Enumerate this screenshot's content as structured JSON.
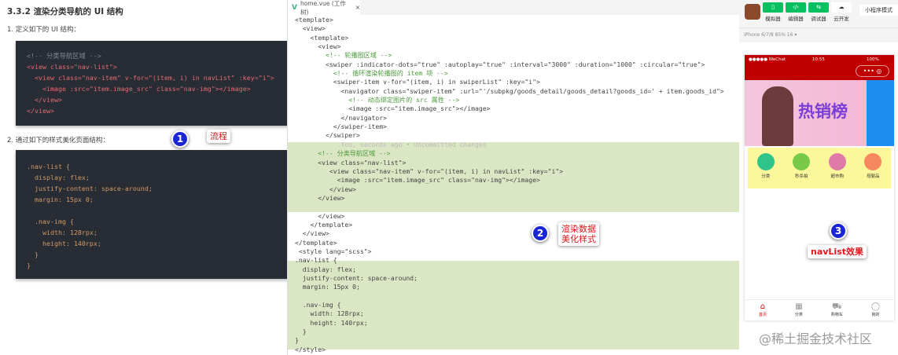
{
  "doc": {
    "heading": "3.3.2 渲染分类导航的 UI 结构",
    "step1": "1. 定义如下的 UI 结构：",
    "code1": [
      "<!-- 分类导航区域 -->",
      "<view class=\"nav-list\">",
      "  <view class=\"nav-item\" v-for=\"(item, i) in navList\" :key=\"i\">",
      "    <image :src=\"item.image_src\" class=\"nav-img\"></image>",
      "  </view>",
      "</view>"
    ],
    "step2": "2. 通过如下的样式美化页面结构：",
    "code2": [
      ".nav-list {",
      "  display: flex;",
      "  justify-content: space-around;",
      "  margin: 15px 0;",
      "",
      "  .nav-img {",
      "    width: 128rpx;",
      "    height: 140rpx;",
      "  }",
      "}"
    ]
  },
  "annotations": [
    {
      "number": "1",
      "label": "流程"
    },
    {
      "number": "2",
      "label_line1": "渲染数据",
      "label_line2": "美化样式"
    },
    {
      "number": "3",
      "label": "navList效果"
    }
  ],
  "editor": {
    "tab_label": "home.vue (工作树)",
    "lines": [
      "<template>",
      "  <view>",
      "    <template>",
      "      <view>",
      "        <!-- 轮播图区域 -->",
      "        <swiper :indicator-dots=\"true\" :autoplay=\"true\" :interval=\"3000\" :duration=\"1000\" :circular=\"true\">",
      "          <!-- 循环渲染轮播图的 item 项 -->",
      "          <swiper-item v-for=\"(item, i) in swiperList\" :key=\"i\">",
      "            <navigator class=\"swiper-item\" :url=\"'/subpkg/goods_detail/goods_detail?goods_id=' + item.goods_id\">",
      "              <!-- 动态绑定图片的 src 属性 -->",
      "              <image :src=\"item.image_src\"></image>",
      "            </navigator>",
      "          </swiper-item>",
      "        </swiper>",
      "            You, seconds ago • Uncommitted changes",
      "      <!-- 分类导航区域 -->",
      "      <view class=\"nav-list\">",
      "         <view class=\"nav-item\" v-for=\"(item, i) in navList\" :key=\"i\">",
      "           <image :src=\"item.image_src\" class=\"nav-img\"></image>",
      "         </view>",
      "      </view>",
      "",
      "      </view>",
      "    </template>",
      "  </view>",
      "</template>",
      " <style lang=\"scss\">",
      ".nav-list {",
      "  display: flex;",
      "  justify-content: space-around;",
      "  margin: 15px 0;",
      "",
      "  .nav-img {",
      "    width: 128rpx;",
      "    height: 140rpx;",
      "  }",
      "}",
      "</style>"
    ]
  },
  "simulator": {
    "toolbar": [
      {
        "icon": "phone-icon",
        "label": "模拟器"
      },
      {
        "icon": "code-icon",
        "label": "编辑器"
      },
      {
        "icon": "debug-icon",
        "label": "调试器"
      },
      {
        "icon": "cloud-icon",
        "label": "云开发"
      }
    ],
    "mode": "小程序模式",
    "device": "iPhone 6/7/8 85% 16 ▾",
    "status": {
      "carrier": "●●●●● WeChat",
      "time": "10:55",
      "battery": "100%"
    },
    "banner_text": "热销榜",
    "nav_items": [
      {
        "label": "分类",
        "color": "#2fc58a"
      },
      {
        "label": "秒杀拍",
        "color": "#78c94a"
      },
      {
        "label": "超市购",
        "color": "#e07aa8"
      },
      {
        "label": "母婴品",
        "color": "#f7875e"
      }
    ],
    "tabs": [
      {
        "label": "首页",
        "glyph": "⌂"
      },
      {
        "label": "分类",
        "glyph": "▦"
      },
      {
        "label": "购物车",
        "glyph": "⛟"
      },
      {
        "label": "我的",
        "glyph": "◯"
      }
    ]
  },
  "watermark": "@稀土掘金技术社区"
}
